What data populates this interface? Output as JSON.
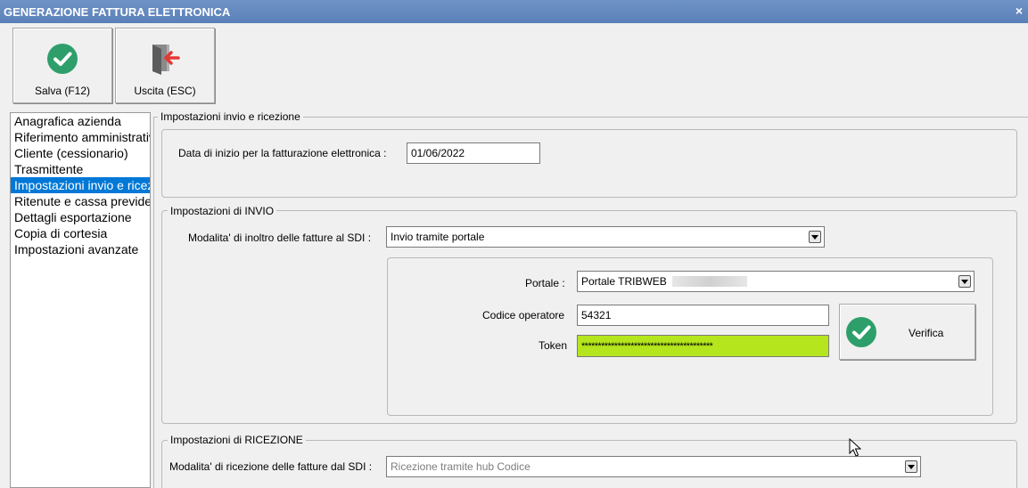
{
  "window": {
    "title": "GENERAZIONE FATTURA ELETTRONICA",
    "close_glyph": "×"
  },
  "toolbar": {
    "save_label": "Salva (F12)",
    "exit_label": "Uscita (ESC)",
    "save_icon": "check-circle-icon",
    "exit_icon": "exit-door-icon"
  },
  "nav": {
    "items": [
      {
        "label": "Anagrafica azienda"
      },
      {
        "label": "Riferimento amministrativo"
      },
      {
        "label": "Cliente (cessionario)"
      },
      {
        "label": "Trasmittente"
      },
      {
        "label": "Impostazioni invio e ricezione"
      },
      {
        "label": "Ritenute e cassa previdenziale"
      },
      {
        "label": "Dettagli esportazione"
      },
      {
        "label": "Copia di cortesia"
      },
      {
        "label": "Impostazioni avanzate"
      }
    ],
    "selected_index": 4
  },
  "settings": {
    "title": "Impostazioni invio e ricezione",
    "start_date_label": "Data di inizio per la fatturazione elettronica :",
    "start_date_value": "01/06/2022"
  },
  "invio": {
    "title": "Impostazioni di INVIO",
    "mode_label": "Modalita' di inoltro delle fatture al SDI :",
    "mode_value": "Invio tramite portale",
    "portal_label": "Portale :",
    "portal_value": "Portale TRIBWEB",
    "operator_label": "Codice operatore",
    "operator_value": "54321",
    "token_label": "Token",
    "token_value": "****************************************",
    "verify_label": "Verifica"
  },
  "ricezione": {
    "title": "Impostazioni di RICEZIONE",
    "mode_label": "Modalita' di ricezione delle fatture dal SDI :",
    "mode_value": "Ricezione tramite hub Codice"
  },
  "colors": {
    "accent": "#0078d7",
    "token_highlight": "#b5e61d",
    "check_green": "#2e9f6b"
  }
}
